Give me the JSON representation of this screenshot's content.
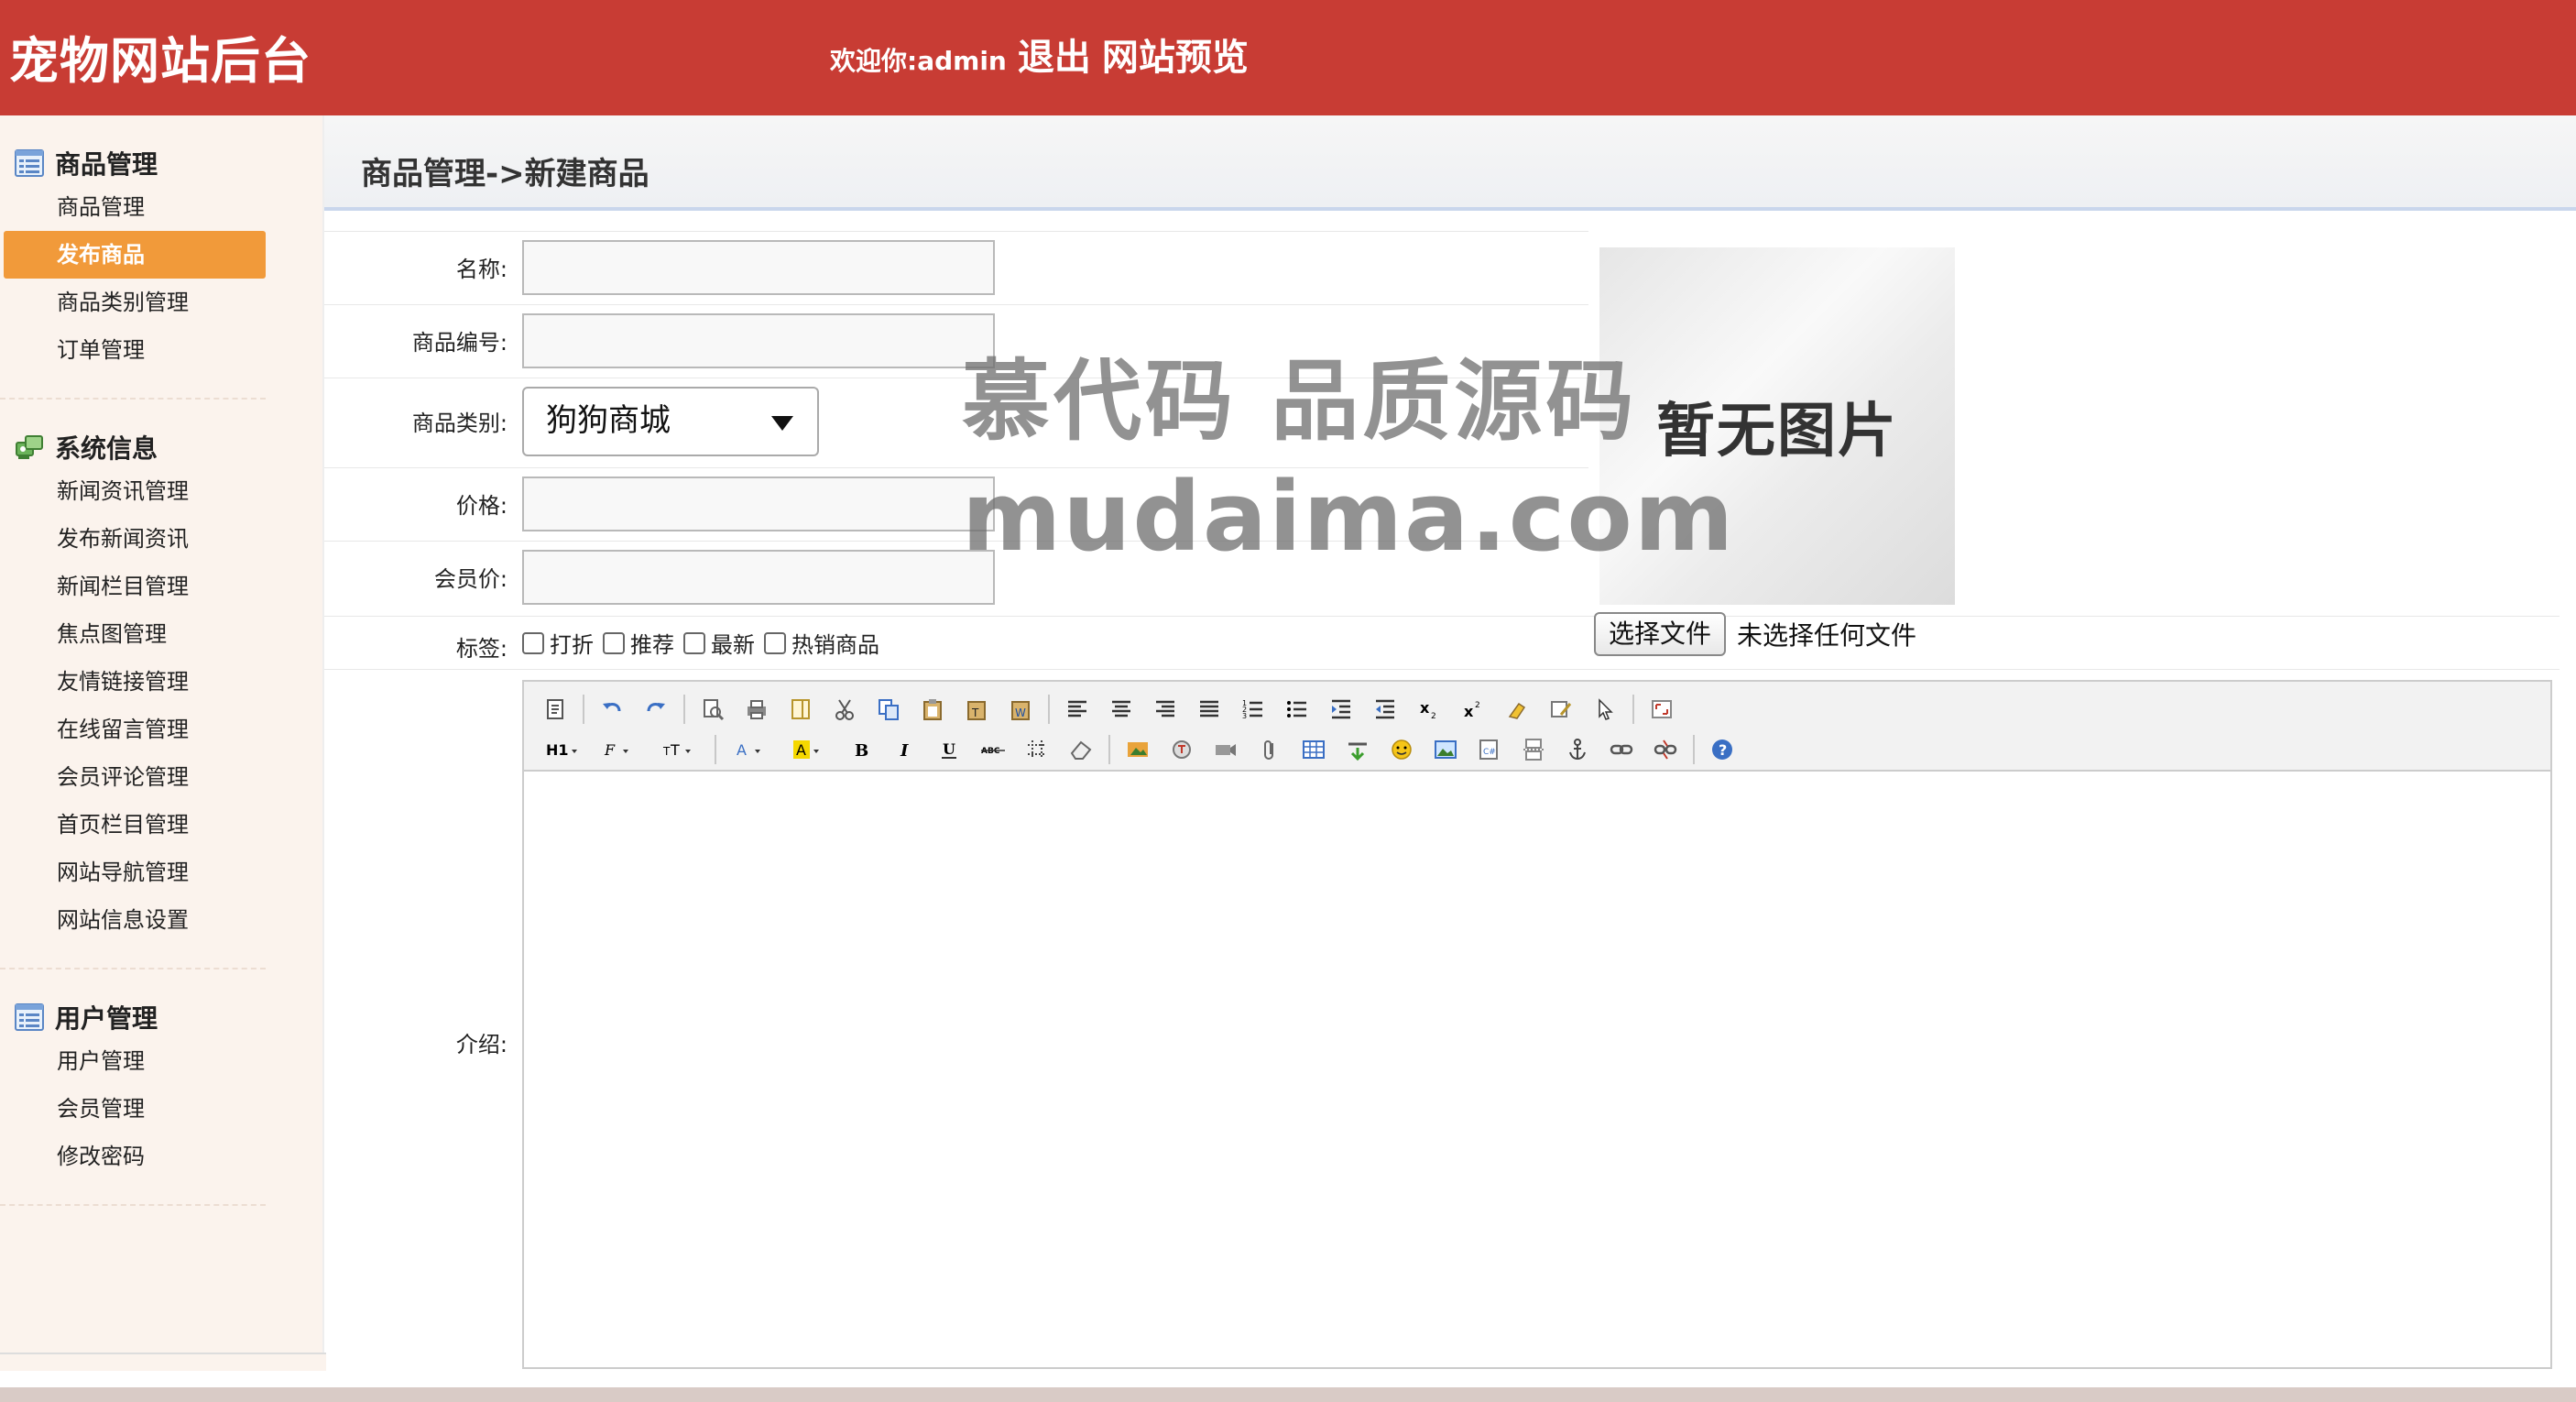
{
  "header": {
    "title": "宠物网站后台",
    "welcome_prefix": "欢迎你:",
    "username": "admin",
    "logout": "退出",
    "preview_site": "网站预览"
  },
  "sidebar": {
    "groups": [
      {
        "title": "商品管理",
        "icon": "list-icon",
        "items": [
          "商品管理",
          "发布商品",
          "商品类别管理",
          "订单管理"
        ]
      },
      {
        "title": "系统信息",
        "icon": "system-info-icon",
        "items": [
          "新闻资讯管理",
          "发布新闻资讯",
          "新闻栏目管理",
          "焦点图管理",
          "友情链接管理",
          "在线留言管理",
          "会员评论管理",
          "首页栏目管理",
          "网站导航管理",
          "网站信息设置"
        ]
      },
      {
        "title": "用户管理",
        "icon": "list-icon",
        "items": [
          "用户管理",
          "会员管理",
          "修改密码"
        ]
      }
    ],
    "active_item": "发布商品"
  },
  "breadcrumb": "商品管理->新建商品",
  "form": {
    "name_label": "名称:",
    "name_value": "",
    "code_label": "商品编号:",
    "code_value": "",
    "category_label": "商品类别:",
    "category_value": "狗狗商城",
    "price_label": "价格:",
    "price_value": "",
    "member_price_label": "会员价:",
    "member_price_value": "",
    "tags_label": "标签:",
    "tags": [
      "打折",
      "推荐",
      "最新",
      "热销商品"
    ],
    "intro_label": "介绍:"
  },
  "image_upload": {
    "placeholder_text": "暂无图片",
    "choose_button": "选择文件",
    "status": "未选择任何文件"
  },
  "watermark": {
    "line1": "慕代码 品质源码",
    "line2": "mudaima.com"
  },
  "colors": {
    "header_bg": "#c83c34",
    "active_menu_bg": "#f19a3a",
    "sidebar_bg": "#fbf3ed"
  }
}
